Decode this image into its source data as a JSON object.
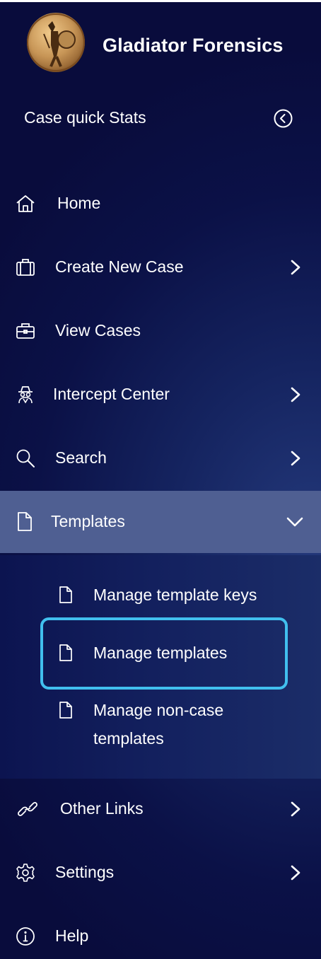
{
  "brand": {
    "name": "Gladiator Forensics",
    "logo_icon": "gladiator-shield-logo"
  },
  "quick_stats": {
    "label": "Case quick Stats",
    "toggle_icon": "chevron-left-circle-icon"
  },
  "nav": {
    "home": {
      "label": "Home",
      "icon": "home-icon"
    },
    "create_case": {
      "label": "Create New Case",
      "icon": "cases-icon"
    },
    "view_cases": {
      "label": "View Cases",
      "icon": "briefcase-icon"
    },
    "intercept": {
      "label": "Intercept Center",
      "icon": "spy-icon"
    },
    "search": {
      "label": "Search",
      "icon": "search-icon"
    },
    "templates": {
      "label": "Templates",
      "icon": "document-icon",
      "expanded": true,
      "children": {
        "keys": {
          "label": "Manage template keys"
        },
        "manage": {
          "label": "Manage templates",
          "selected": true
        },
        "noncase_line1": {
          "label": "Manage non-case"
        },
        "noncase_line2": {
          "label": "templates"
        }
      }
    },
    "other_links": {
      "label": "Other Links",
      "icon": "link-icon"
    },
    "settings": {
      "label": "Settings",
      "icon": "gear-icon"
    },
    "help": {
      "label": "Help",
      "icon": "info-icon"
    }
  },
  "colors": {
    "sidebar_bg": "#0b1147",
    "active_bg": "#4f5f92",
    "highlight_border": "#41bfee",
    "text": "#ffffff"
  }
}
